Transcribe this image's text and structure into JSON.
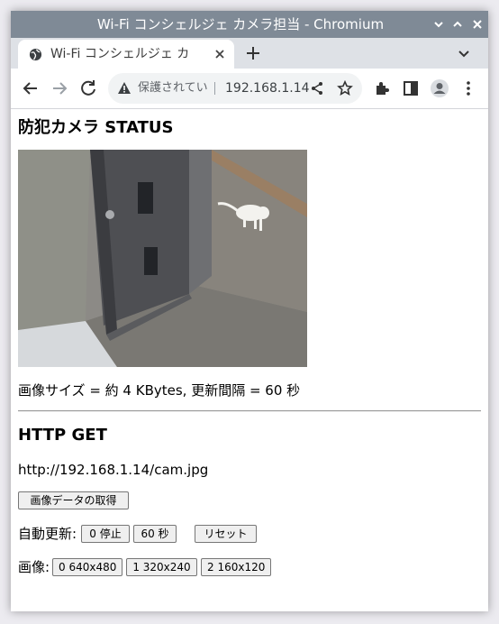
{
  "window": {
    "title": "Wi-Fi コンシェルジェ カメラ担当 - Chromium",
    "controls": [
      "minimize",
      "maximize",
      "close"
    ]
  },
  "tabs": [
    {
      "title": "Wi-Fi コンシェルジェ カ",
      "active": true
    }
  ],
  "toolbar": {
    "security_text": "保護されてい",
    "url": "192.168.1.14"
  },
  "page": {
    "title": "防犯カメラ STATUS",
    "info": "画像サイズ = 約 4 KBytes, 更新間隔 = 60 秒",
    "section_title": "HTTP GET",
    "get_url": "http://192.168.1.14/cam.jpg",
    "fetch_button": "画像データの取得",
    "auto_update": {
      "label": "自動更新:",
      "buttons": [
        "0 停止",
        "60 秒",
        "リセット"
      ]
    },
    "image": {
      "label": "画像:",
      "buttons": [
        "0 640x480",
        "1 320x240",
        "2 160x120"
      ]
    }
  },
  "colors": {
    "titlebar": "#7f8a96",
    "tabstrip": "#dee1e6",
    "omnibox": "#f1f3f4"
  }
}
